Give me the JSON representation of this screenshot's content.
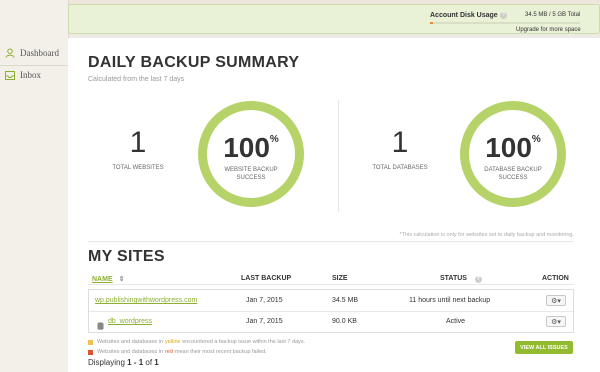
{
  "sidebar": {
    "items": [
      {
        "label": "Dashboard",
        "icon": "user-icon"
      },
      {
        "label": "Inbox",
        "icon": "inbox-icon"
      }
    ]
  },
  "header": {
    "disk_title": "Account Disk Usage",
    "disk_value": "34.5 MB / 5 GB Total",
    "disk_progress": 0.007,
    "upgrade_label": "Upgrade for more space",
    "help_glyph": "?"
  },
  "summary": {
    "title": "DAILY BACKUP SUMMARY",
    "subtitle": "Calculated from the last 7 days",
    "websites": {
      "count": "1",
      "count_label": "TOTAL WEBSITES",
      "percent": "100",
      "percent_symbol": "%",
      "percent_label": "WEBSITE BACKUP SUCCESS"
    },
    "databases": {
      "count": "1",
      "count_label": "TOTAL DATABASES",
      "percent": "100",
      "percent_symbol": "%",
      "percent_label": "DATABASE BACKUP SUCCESS"
    },
    "note": "*This calculation is only for websites set to daily backup and monitoring."
  },
  "sites": {
    "title": "MY SITES",
    "columns": {
      "name": "NAME",
      "sort_glyph": "⇕",
      "last_backup": "LAST BACKUP",
      "size": "SIZE",
      "status": "STATUS",
      "action": "ACTION"
    },
    "rows": [
      {
        "name": "wp.publishingwithwordpress.com",
        "last_backup": "Jan 7, 2015",
        "size": "34.5 MB",
        "status": "11 hours until next backup",
        "action": "⚙▾"
      },
      {
        "name": "db_wordpress",
        "last_backup": "Jan 7, 2015",
        "size": "90.0 KB",
        "status": "Active",
        "action": "⚙▾"
      }
    ],
    "legend": [
      {
        "pre": "Websites and databases in ",
        "word": "yellow",
        "post": " encountered a backup issue within the last 7 days.",
        "color": "#f0c24b"
      },
      {
        "pre": "Websites and databases in ",
        "word": "red",
        "post": " mean their most recent backup failed.",
        "color": "#e0532f"
      }
    ],
    "view_all": "VIEW ALL ISSUES",
    "displaying_prefix": "Displaying ",
    "displaying_range": "1 - 1",
    "displaying_mid": " of ",
    "displaying_total": "1"
  },
  "colors": {
    "accent": "#93bb2f",
    "ring": "#b6d36a",
    "header_bg": "#e9f1d7",
    "progress": "#e38e3b"
  }
}
